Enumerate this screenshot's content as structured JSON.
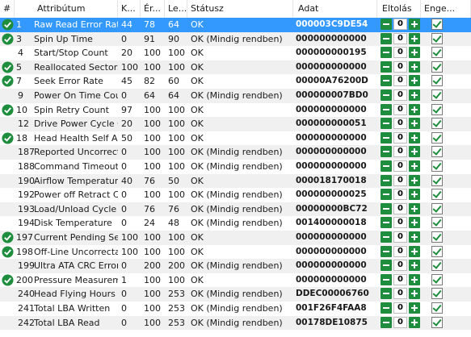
{
  "headers": {
    "id": "#",
    "attribute": "Attribútum",
    "current": "K...",
    "worst": "Ér...",
    "threshold": "Le...",
    "status": "Státusz",
    "data": "Adat",
    "offset": "Eltolás",
    "enabled": "Enge..."
  },
  "colors": {
    "selected": "#3399ff",
    "ok_icon": "#1e8e3e",
    "button": "#1e8e3e"
  },
  "rows": [
    {
      "id": "1",
      "name": "Raw Read Error Rate",
      "cur": "44",
      "worst": "78",
      "thr": "64",
      "status": "OK",
      "data": "000003C9DE54",
      "offset": "0",
      "ok": true
    },
    {
      "id": "3",
      "name": "Spin Up Time",
      "cur": "0",
      "worst": "91",
      "thr": "90",
      "status": "OK (Mindig rendben)",
      "data": "000000000000",
      "offset": "0",
      "ok": true
    },
    {
      "id": "4",
      "name": "Start/Stop Count",
      "cur": "20",
      "worst": "100",
      "thr": "100",
      "status": "OK",
      "data": "000000000195",
      "offset": "0",
      "ok": false
    },
    {
      "id": "5",
      "name": "Reallocated Sectors ...",
      "cur": "100",
      "worst": "100",
      "thr": "100",
      "status": "OK",
      "data": "000000000000",
      "offset": "0",
      "ok": true
    },
    {
      "id": "7",
      "name": "Seek Error Rate",
      "cur": "45",
      "worst": "82",
      "thr": "60",
      "status": "OK",
      "data": "00000A76200D",
      "offset": "0",
      "ok": true
    },
    {
      "id": "9",
      "name": "Power On Time Count",
      "cur": "0",
      "worst": "64",
      "thr": "64",
      "status": "OK (Mindig rendben)",
      "data": "000000007BD0",
      "offset": "0",
      "ok": false
    },
    {
      "id": "10",
      "name": "Spin Retry Count",
      "cur": "97",
      "worst": "100",
      "thr": "100",
      "status": "OK",
      "data": "000000000000",
      "offset": "0",
      "ok": true
    },
    {
      "id": "12",
      "name": "Drive Power Cycle C...",
      "cur": "20",
      "worst": "100",
      "thr": "100",
      "status": "OK",
      "data": "000000000051",
      "offset": "0",
      "ok": false
    },
    {
      "id": "18",
      "name": "Head Health Self Ass...",
      "cur": "50",
      "worst": "100",
      "thr": "100",
      "status": "OK",
      "data": "000000000000",
      "offset": "0",
      "ok": true
    },
    {
      "id": "187",
      "name": "Reported Uncorrect...",
      "cur": "0",
      "worst": "100",
      "thr": "100",
      "status": "OK (Mindig rendben)",
      "data": "000000000000",
      "offset": "0",
      "ok": false
    },
    {
      "id": "188",
      "name": "Command Timeout",
      "cur": "0",
      "worst": "100",
      "thr": "100",
      "status": "OK (Mindig rendben)",
      "data": "000000000000",
      "offset": "0",
      "ok": false
    },
    {
      "id": "190",
      "name": "Airflow Temperature",
      "cur": "40",
      "worst": "76",
      "thr": "50",
      "status": "OK",
      "data": "000018170018",
      "offset": "0",
      "ok": false
    },
    {
      "id": "192",
      "name": "Power off Retract Cy...",
      "cur": "0",
      "worst": "100",
      "thr": "100",
      "status": "OK (Mindig rendben)",
      "data": "000000000025",
      "offset": "0",
      "ok": false
    },
    {
      "id": "193",
      "name": "Load/Unload Cycle ...",
      "cur": "0",
      "worst": "76",
      "thr": "76",
      "status": "OK (Mindig rendben)",
      "data": "00000000BC72",
      "offset": "0",
      "ok": false
    },
    {
      "id": "194",
      "name": "Disk Temperature",
      "cur": "0",
      "worst": "24",
      "thr": "48",
      "status": "OK (Mindig rendben)",
      "data": "001400000018",
      "offset": "0",
      "ok": false
    },
    {
      "id": "197",
      "name": "Current Pending Sec...",
      "cur": "100",
      "worst": "100",
      "thr": "100",
      "status": "OK",
      "data": "000000000000",
      "offset": "0",
      "ok": true
    },
    {
      "id": "198",
      "name": "Off-Line Uncorrecta...",
      "cur": "100",
      "worst": "100",
      "thr": "100",
      "status": "OK",
      "data": "000000000000",
      "offset": "0",
      "ok": true
    },
    {
      "id": "199",
      "name": "Ultra ATA CRC Error ...",
      "cur": "0",
      "worst": "200",
      "thr": "200",
      "status": "OK (Mindig rendben)",
      "data": "000000000000",
      "offset": "0",
      "ok": false
    },
    {
      "id": "200",
      "name": "Pressure Measurem...",
      "cur": "1",
      "worst": "100",
      "thr": "100",
      "status": "OK",
      "data": "000000000000",
      "offset": "0",
      "ok": true
    },
    {
      "id": "240",
      "name": "Head Flying Hours",
      "cur": "0",
      "worst": "100",
      "thr": "253",
      "status": "OK (Mindig rendben)",
      "data": "DDEC00006760",
      "offset": "0",
      "ok": false
    },
    {
      "id": "241",
      "name": "Total LBA Written",
      "cur": "0",
      "worst": "100",
      "thr": "253",
      "status": "OK (Mindig rendben)",
      "data": "001F26F4FAA8",
      "offset": "0",
      "ok": false
    },
    {
      "id": "242",
      "name": "Total LBA Read",
      "cur": "0",
      "worst": "100",
      "thr": "253",
      "status": "OK (Mindig rendben)",
      "data": "00178DE10875",
      "offset": "0",
      "ok": false
    }
  ]
}
